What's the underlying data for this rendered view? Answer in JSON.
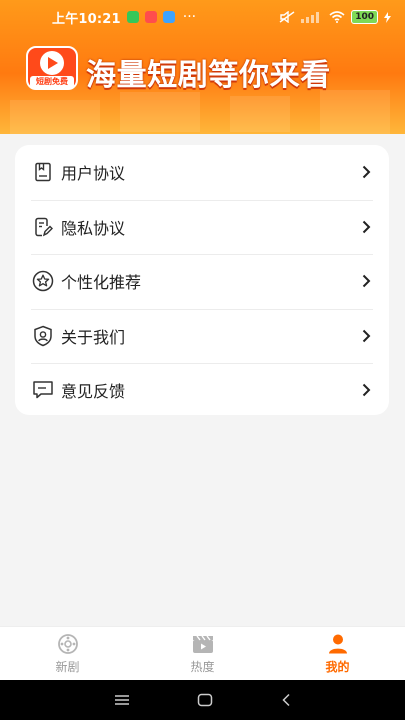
{
  "status_bar": {
    "time": "上午10:21",
    "dots": "···",
    "battery": "100",
    "colors": {
      "green": "#35c759",
      "red": "#ff4d4d",
      "blue": "#3ea3ff"
    }
  },
  "banner": {
    "logo_tag": "短剧免费",
    "slogan": "海量短剧等你来看",
    "colors": {
      "top": "#ff9a1a",
      "bottom": "#ffb63a"
    }
  },
  "menu": {
    "items": [
      {
        "label": "用户协议",
        "icon": "document-icon"
      },
      {
        "label": "隐私协议",
        "icon": "edit-document-icon"
      },
      {
        "label": "个性化推荐",
        "icon": "star-icon"
      },
      {
        "label": "关于我们",
        "icon": "shield-user-icon"
      },
      {
        "label": "意见反馈",
        "icon": "message-icon"
      }
    ]
  },
  "tabs": [
    {
      "label": "新剧",
      "icon": "film-reel-icon",
      "active": false
    },
    {
      "label": "热度",
      "icon": "clapperboard-icon",
      "active": false
    },
    {
      "label": "我的",
      "icon": "user-icon",
      "active": true
    }
  ],
  "accent_color": "#ff6a00"
}
